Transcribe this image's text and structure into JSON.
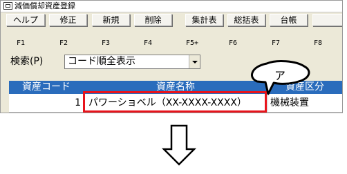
{
  "window": {
    "title": "減価償却資産登録",
    "icon": "app-window-icon"
  },
  "toolbar": {
    "buttons": [
      {
        "label": "ヘルプ",
        "key": "F1"
      },
      {
        "label": "修正",
        "key": "F2"
      },
      {
        "label": "新規",
        "key": "F3"
      },
      {
        "label": "削除",
        "key": "F4"
      },
      {
        "label": "集計表",
        "key": "F5+"
      },
      {
        "label": "総括表",
        "key": "F6"
      },
      {
        "label": "台帳",
        "key": "F7"
      },
      {
        "label": "",
        "key": "F8"
      }
    ]
  },
  "search": {
    "label": "検索(P)",
    "value": "コード順全表示"
  },
  "grid": {
    "columns": [
      "資産コード",
      "資産名称",
      "資産区分"
    ],
    "rows": [
      {
        "code": "1",
        "name": "パワーショベル（XX-XXXX-XXXX）",
        "category": "機械装置"
      }
    ]
  },
  "annotation": {
    "callout_label": "ア",
    "highlight_color": "#e8141c"
  },
  "colors": {
    "header_blue": "#2a6cbc",
    "window_bg": "#ece9d8"
  }
}
